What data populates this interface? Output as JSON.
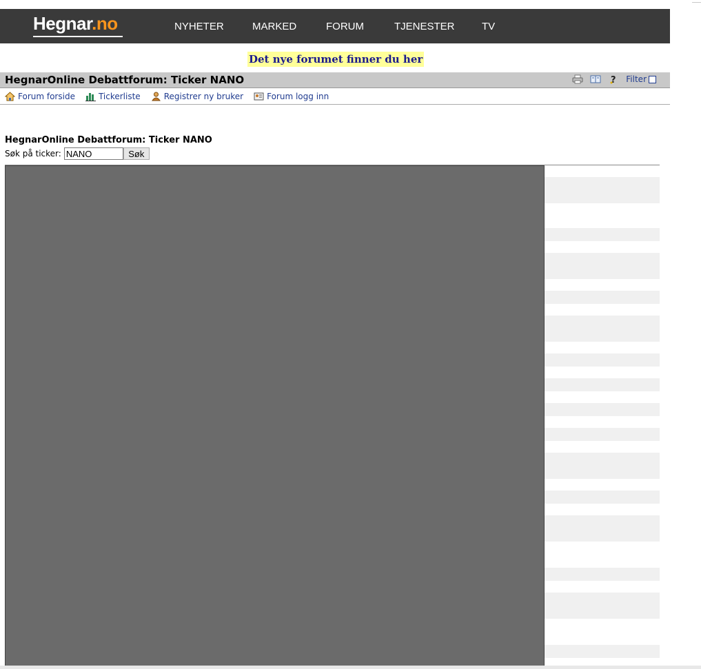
{
  "header": {
    "logo_part1": "Hegnar",
    "logo_part2": ".no",
    "nav": [
      "NYHETER",
      "MARKED",
      "FORUM",
      "TJENESTER",
      "TV"
    ]
  },
  "announcement": "Det nye forumet finner du her",
  "titlebar": {
    "title": "HegnarOnline Debattforum: Ticker NANO",
    "filter_label": "Filter",
    "icons": [
      "print-icon",
      "book-icon",
      "help-icon"
    ]
  },
  "toolbar": {
    "items": [
      {
        "label": "Forum forside",
        "icon": "home-icon"
      },
      {
        "label": "Tickerliste",
        "icon": "chart-icon"
      },
      {
        "label": "Registrer ny bruker",
        "icon": "user-icon"
      },
      {
        "label": "Forum logg inn",
        "icon": "login-icon"
      }
    ]
  },
  "search": {
    "heading": "HegnarOnline Debattforum: Ticker NANO",
    "label": "Søk på ticker:",
    "value": "NANO",
    "button": "Søk"
  },
  "colors": {
    "nav_bg": "#3a3a3a",
    "logo_accent": "#f7941d",
    "announce_bg": "#ffff99",
    "link": "#1f3b8f",
    "redacted": "#6b6b6b"
  }
}
